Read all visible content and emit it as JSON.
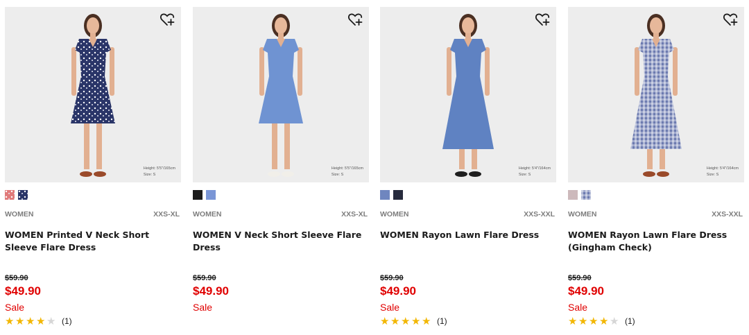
{
  "products": [
    {
      "wishlist_icon": "heart-plus-icon",
      "caption_height": "Height: 5'5\"/165cm",
      "caption_size": "Size: S",
      "dress_color": "#2a3568",
      "pattern": "floral",
      "swatches": [
        {
          "color": "#e07a7a",
          "pattern": "dots"
        },
        {
          "color": "#2a3568",
          "pattern": "dots"
        }
      ],
      "category": "WOMEN",
      "size_range": "XXS-XL",
      "name": "WOMEN Printed V Neck Short Sleeve Flare Dress",
      "original_price": "$59.90",
      "sale_price": "$49.90",
      "flag": "Sale",
      "rating": 4,
      "review_count": "(1)"
    },
    {
      "wishlist_icon": "heart-plus-icon",
      "caption_height": "Height: 5'5\"/165cm",
      "caption_size": "Size: S",
      "dress_color": "#6f93d2",
      "pattern": "solid",
      "swatches": [
        {
          "color": "#1c1c1c",
          "pattern": "solid"
        },
        {
          "color": "#7a96d6",
          "pattern": "solid"
        }
      ],
      "category": "WOMEN",
      "size_range": "XXS-XL",
      "name": "WOMEN V Neck Short Sleeve Flare Dress",
      "original_price": "$59.90",
      "sale_price": "$49.90",
      "flag": "Sale",
      "rating": null,
      "review_count": ""
    },
    {
      "wishlist_icon": "heart-plus-icon",
      "caption_height": "Height: 5'4\"/164cm",
      "caption_size": "Size: S",
      "dress_color": "#5f82c2",
      "pattern": "solid",
      "swatches": [
        {
          "color": "#6f86bf",
          "pattern": "solid"
        },
        {
          "color": "#272b3d",
          "pattern": "solid"
        }
      ],
      "category": "WOMEN",
      "size_range": "XXS-XXL",
      "name": "WOMEN Rayon Lawn Flare Dress",
      "original_price": "$59.90",
      "sale_price": "$49.90",
      "flag": "Sale",
      "rating": 5,
      "review_count": "(1)"
    },
    {
      "wishlist_icon": "heart-plus-icon",
      "caption_height": "Height: 5'4\"/164cm",
      "caption_size": "Size: S",
      "dress_color": "#6d7bb0",
      "pattern": "gingham",
      "swatches": [
        {
          "color": "#cdb9bb",
          "pattern": "solid"
        },
        {
          "color": "#6d7bb0",
          "pattern": "gingham"
        }
      ],
      "category": "WOMEN",
      "size_range": "XXS-XXL",
      "name": "WOMEN Rayon Lawn Flare Dress (Gingham Check)",
      "original_price": "$59.90",
      "sale_price": "$49.90",
      "flag": "Sale",
      "rating": 4,
      "review_count": "(1)"
    }
  ]
}
